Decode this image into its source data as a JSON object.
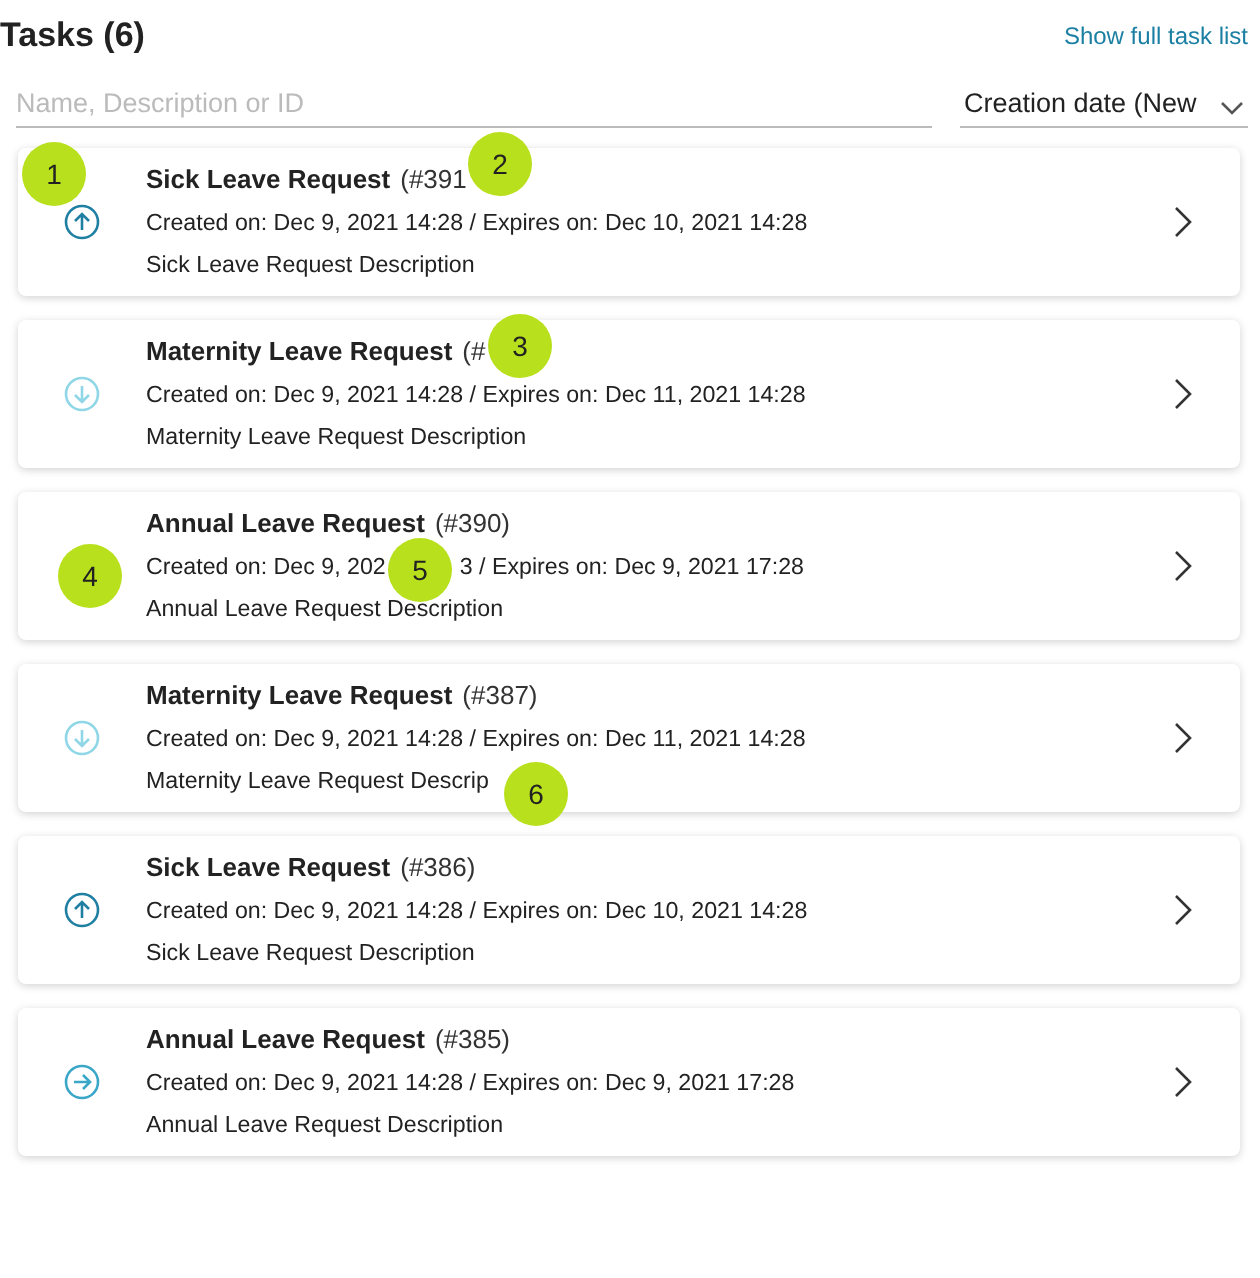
{
  "header": {
    "title": "Tasks (6)",
    "link": "Show full task list"
  },
  "search": {
    "placeholder": "Name, Description or ID"
  },
  "sort": {
    "value": "Creation date (New"
  },
  "tasks": [
    {
      "title": "Sick Leave Request",
      "id": "(#391",
      "dates": [
        "Created on: Dec 9, 2021 14:28 / Expires on: Dec 10, 2021 14:28"
      ],
      "description": "Sick Leave Request Description",
      "kind": "up"
    },
    {
      "title": "Maternity Leave Request",
      "id": "(#",
      "dates": [
        "Created on: Dec 9, 2021 14:28 / Expires on: Dec 11, 2021 14:28"
      ],
      "description": "Maternity Leave Request Description",
      "kind": "down"
    },
    {
      "title": "Annual Leave Request",
      "id": "(#390)",
      "dates": [
        "Created on: Dec 9, 202",
        "3 / Expires on: Dec 9, 2021 17:28"
      ],
      "description": "Annual Leave Request Description",
      "kind": "none"
    },
    {
      "title": "Maternity Leave Request",
      "id": "(#387)",
      "dates": [
        "Created on: Dec 9, 2021 14:28 / Expires on: Dec 11, 2021 14:28"
      ],
      "description": "Maternity Leave Request Descrip",
      "kind": "down"
    },
    {
      "title": "Sick Leave Request",
      "id": "(#386)",
      "dates": [
        "Created on: Dec 9, 2021 14:28 / Expires on: Dec 10, 2021 14:28"
      ],
      "description": "Sick Leave Request Description",
      "kind": "up"
    },
    {
      "title": "Annual Leave Request",
      "id": "(#385)",
      "dates": [
        "Created on: Dec 9, 2021 14:28 / Expires on: Dec 9, 2021 17:28"
      ],
      "description": "Annual Leave Request Description",
      "kind": "right"
    }
  ],
  "markers": [
    "1",
    "2",
    "3",
    "4",
    "5",
    "6"
  ]
}
